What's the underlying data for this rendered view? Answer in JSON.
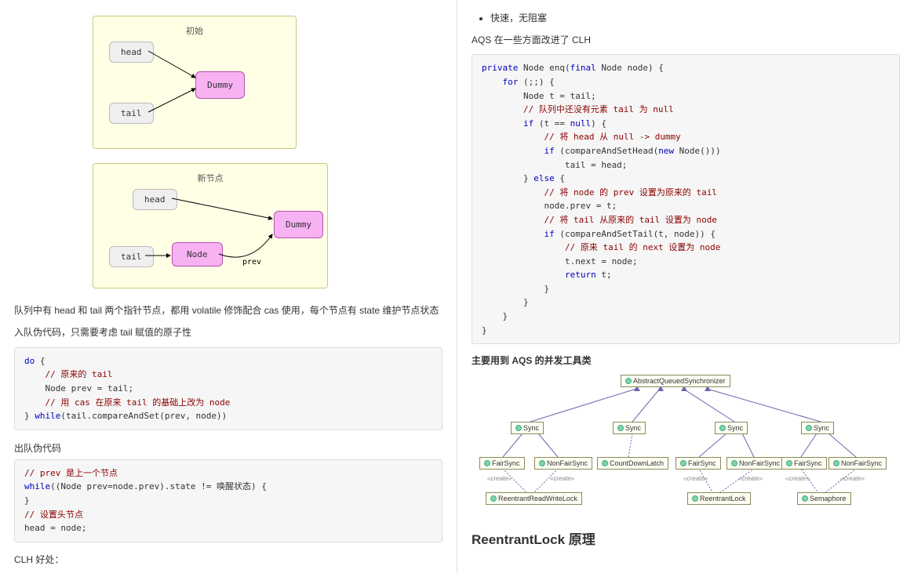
{
  "left": {
    "diagram1": {
      "title": "初始",
      "head": "head",
      "tail": "tail",
      "dummy": "Dummy"
    },
    "diagram2": {
      "title": "新节点",
      "head": "head",
      "tail": "tail",
      "node": "Node",
      "dummy": "Dummy",
      "prev": "prev"
    },
    "para1": "队列中有 head 和 tail 两个指针节点，都用 volatile 修饰配合 cas 使用，每个节点有 state 维护节点状态",
    "para2": "入队伪代码，只需要考虑 tail 赋值的原子性",
    "code1": "do {\n    // 原来的 tail\n    Node prev = tail;\n    // 用 cas 在原来 tail 的基础上改为 node\n} while(tail.compareAndSet(prev, node))",
    "dequeue_label": "出队伪代码",
    "code2": "// prev 是上一个节点\nwhile((Node prev=node.prev).state != 唤醒状态) {\n}\n// 设置头节点\nhead = node;",
    "clh_label": "CLH 好处："
  },
  "right": {
    "bullet1": "快速，无阻塞",
    "intro": "AQS 在一些方面改进了 CLH",
    "code": "private Node enq(final Node node) {\n    for (;;) {\n        Node t = tail;\n        // 队列中还没有元素 tail 为 null\n        if (t == null) {\n            // 将 head 从 null -> dummy\n            if (compareAndSetHead(new Node()))\n                tail = head;\n        } else {\n            // 将 node 的 prev 设置为原来的 tail\n            node.prev = t;\n            // 将 tail 从原来的 tail 设置为 node\n            if (compareAndSetTail(t, node)) {\n                // 原来 tail 的 next 设置为 node\n                t.next = node;\n                return t;\n            }\n        }\n    }\n}",
    "section_title": "主要用到 AQS 的并发工具类",
    "uml": {
      "root": "AbstractQueuedSynchronizer",
      "sync": "Sync",
      "fair": "FairSync",
      "nonfair": "NonFairSync",
      "cdl": "CountDownLatch",
      "rrwl": "ReentrantReadWriteLock",
      "rl": "ReentrantLock",
      "sem": "Semaphore",
      "create": "«create»"
    },
    "heading": "ReentrantLock 原理"
  }
}
